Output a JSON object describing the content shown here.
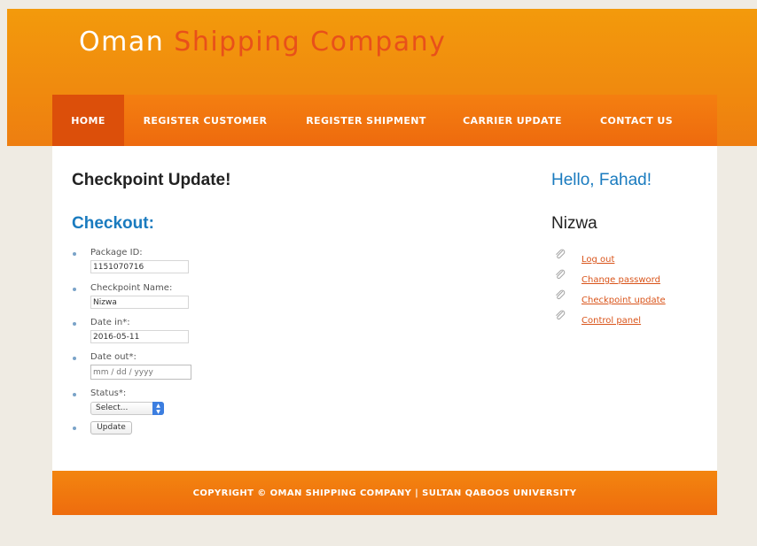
{
  "site": {
    "title_part1": "Oman",
    "title_part2": "Shipping Company"
  },
  "nav": {
    "items": [
      {
        "label": "HOME"
      },
      {
        "label": "REGISTER CUSTOMER"
      },
      {
        "label": "REGISTER SHIPMENT"
      },
      {
        "label": "CARRIER UPDATE"
      },
      {
        "label": "CONTACT US"
      }
    ]
  },
  "main": {
    "page_heading": "Checkpoint Update!",
    "form_heading": "Checkout:",
    "fields": {
      "package_id": {
        "label": "Package ID:",
        "value": "1151070716"
      },
      "checkpoint_name": {
        "label": "Checkpoint Name:",
        "value": "Nizwa"
      },
      "date_in": {
        "label": "Date in*:",
        "value": "2016-05-11"
      },
      "date_out": {
        "label": "Date out*:",
        "placeholder": "mm / dd / yyyy"
      },
      "status": {
        "label": "Status*:",
        "selected": "Select..."
      }
    },
    "submit_label": "Update"
  },
  "sidebar": {
    "greeting": "Hello, Fahad!",
    "location": "Nizwa",
    "links": [
      {
        "label": "Log out"
      },
      {
        "label": "Change password"
      },
      {
        "label": "Checkpoint update"
      },
      {
        "label": "Control panel"
      }
    ]
  },
  "footer": {
    "text": "COPYRIGHT © OMAN SHIPPING COMPANY | SULTAN QABOOS UNIVERSITY"
  },
  "colors": {
    "header_orange": "#f39a0c",
    "nav_orange": "#ee6a0e",
    "nav_active": "#dc4f0a",
    "title_accent": "#e8501a",
    "link_blue": "#1a7bbf",
    "sidebar_link": "#d9541a",
    "page_background": "#efebe3"
  },
  "icons": {
    "sidebar_link_icon": "paperclip-icon",
    "select_arrow_icon": "chevron-updown-icon"
  }
}
